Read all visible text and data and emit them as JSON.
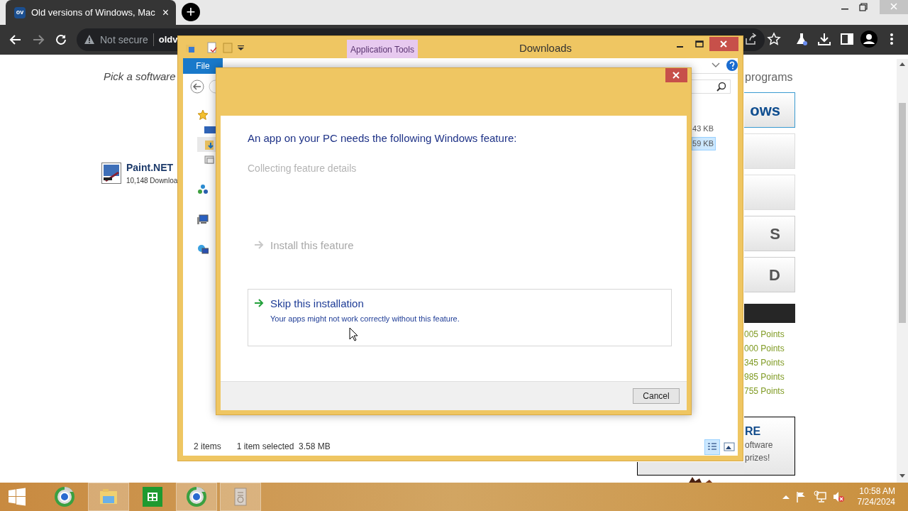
{
  "browser": {
    "tab": {
      "favicon": "ov",
      "title": "Old versions of Windows, Mac",
      "close": "×"
    },
    "new_tab": "+",
    "security": "Not secure",
    "url": "oldv"
  },
  "page": {
    "tagline": "Pick a software",
    "heading_right": "programs",
    "software": [
      {
        "name": "Paint.NET",
        "downloads": "10,148 Downloa"
      }
    ],
    "side_boxes": [
      {
        "kind": "logo",
        "label": "ows"
      },
      {
        "kind": "blank"
      },
      {
        "kind": "blank"
      },
      {
        "kind": "grey",
        "label": "S"
      },
      {
        "kind": "grey",
        "label": "D"
      }
    ],
    "points": [
      "005 Points",
      "000 Points",
      "345 Points",
      "985 Points",
      "755 Points"
    ],
    "promo": {
      "title": "RE",
      "lines": [
        "oftware",
        "prizes!"
      ]
    }
  },
  "explorer": {
    "title": "Downloads",
    "context_tab": "Application Tools",
    "file_tab": "File",
    "nav": [
      {
        "kind": "star",
        "children": [
          {
            "kind": "desktop",
            "selected": false
          },
          {
            "kind": "downloads",
            "selected": true
          },
          {
            "kind": "recent",
            "selected": false
          }
        ]
      },
      {
        "kind": "homegroup"
      },
      {
        "kind": "pc"
      },
      {
        "kind": "network"
      }
    ],
    "sizes": [
      {
        "text": "43 KB",
        "selected": false
      },
      {
        "text": "59 KB",
        "selected": true
      }
    ],
    "status": {
      "count": "2 items",
      "selection": "1 item selected  3.58 MB"
    },
    "views": [
      {
        "kind": "details",
        "selected": true
      },
      {
        "kind": "tiles",
        "selected": false
      }
    ]
  },
  "dialog": {
    "heading": "An app on your PC needs the following Windows feature:",
    "status": "Collecting feature details",
    "options": [
      {
        "title": "Install this feature",
        "disabled": true,
        "hovered": false
      },
      {
        "title": "Skip this installation",
        "description": "Your apps might not work correctly without this feature.",
        "disabled": false,
        "hovered": true
      }
    ],
    "cancel": "Cancel"
  },
  "taskbar": {
    "apps": [
      {
        "kind": "chrome",
        "active": false
      },
      {
        "kind": "explorer",
        "active": true
      },
      {
        "kind": "store",
        "active": false
      },
      {
        "kind": "chrome",
        "active": true
      },
      {
        "kind": "archive",
        "active": true
      }
    ],
    "time": "10:58 AM",
    "date": "7/24/2024"
  }
}
